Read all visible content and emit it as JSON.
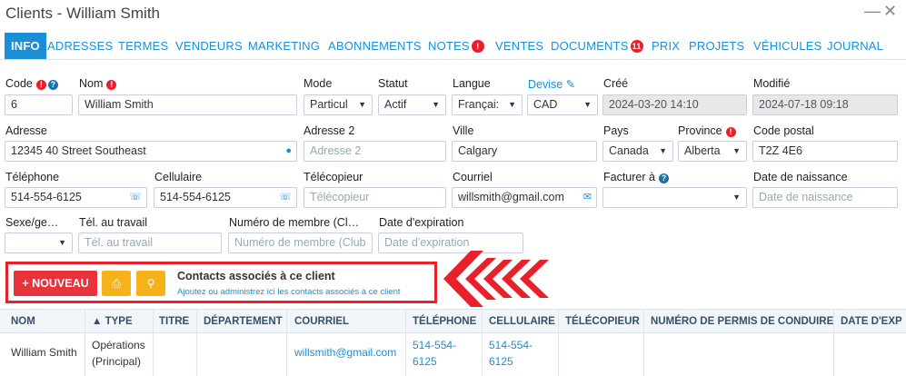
{
  "window": {
    "title": "Clients - William Smith",
    "minimize": "—",
    "close": "✕"
  },
  "tabs": [
    {
      "label": "INFO",
      "active": true
    },
    {
      "label": "ADRESSES"
    },
    {
      "label": "TERMES"
    },
    {
      "label": "VENDEURS"
    },
    {
      "label": "MARKETING"
    },
    {
      "label": "ABONNEMENTS"
    },
    {
      "label": "NOTES",
      "badge": "!"
    },
    {
      "label": "VENTES"
    },
    {
      "label": "DOCUMENTS",
      "badge": "11"
    },
    {
      "label": "PRIX"
    },
    {
      "label": "PROJETS"
    },
    {
      "label": "VÉHICULES"
    },
    {
      "label": "JOURNAL"
    }
  ],
  "form": {
    "code": {
      "label": "Code",
      "value": "6"
    },
    "nom": {
      "label": "Nom",
      "value": "William Smith"
    },
    "mode": {
      "label": "Mode",
      "value": "Particul"
    },
    "statut": {
      "label": "Statut",
      "value": "Actif"
    },
    "langue": {
      "label": "Langue",
      "value": "Françai:"
    },
    "devise": {
      "label": "Devise",
      "value": "CAD"
    },
    "cree": {
      "label": "Créé",
      "value": "2024-03-20 14:10"
    },
    "modifie": {
      "label": "Modifié",
      "value": "2024-07-18 09:18"
    },
    "adresse": {
      "label": "Adresse",
      "value": "12345 40 Street Southeast"
    },
    "adresse2": {
      "label": "Adresse 2",
      "placeholder": "Adresse 2"
    },
    "ville": {
      "label": "Ville",
      "value": "Calgary"
    },
    "pays": {
      "label": "Pays",
      "value": "Canada"
    },
    "province": {
      "label": "Province",
      "value": "Alberta"
    },
    "code_postal": {
      "label": "Code postal",
      "value": "T2Z 4E6"
    },
    "telephone": {
      "label": "Téléphone",
      "value": "514-554-6125"
    },
    "cellulaire": {
      "label": "Cellulaire",
      "value": "514-554-6125"
    },
    "telecopieur": {
      "label": "Télécopieur",
      "placeholder": "Télécopieur"
    },
    "courriel": {
      "label": "Courriel",
      "value": "willsmith@gmail.com"
    },
    "facturer": {
      "label": "Facturer à",
      "value": ""
    },
    "naissance": {
      "label": "Date de naissance",
      "placeholder": "Date de naissance"
    },
    "sexe": {
      "label": "Sexe/ge…",
      "value": ""
    },
    "tel_travail": {
      "label": "Tél. au travail",
      "placeholder": "Tél. au travail"
    },
    "membre": {
      "label": "Numéro de membre (Cl…",
      "placeholder": "Numéro de membre (Club"
    },
    "expiration": {
      "label": "Date d'expiration",
      "placeholder": "Date d'expiration"
    }
  },
  "contacts": {
    "new_button": "+ NOUVEAU",
    "title": "Contacts associés à ce client",
    "subtitle": "Ajoutez ou administrez ici les contacts associés à ce client",
    "columns": [
      "NOM",
      "▲ TYPE",
      "TITRE",
      "DÉPARTEMENT",
      "COURRIEL",
      "TÉLÉPHONE",
      "CELLULAIRE",
      "TÉLÉCOPIEUR",
      "NUMÉRO DE PERMIS DE CONDUIRE",
      "DATE D'EXP"
    ],
    "row": {
      "nom": "William Smith",
      "type_1": "Opérations",
      "type_2": "(Principal)",
      "courriel": "willsmith@gmail.com",
      "tel_1": "514-554-",
      "tel_2": "6125",
      "cell_1": "514-554-",
      "cell_2": "6125"
    }
  },
  "colors": {
    "accent": "#1a8fd6",
    "danger": "#e8202a",
    "warning": "#f5b21b"
  }
}
